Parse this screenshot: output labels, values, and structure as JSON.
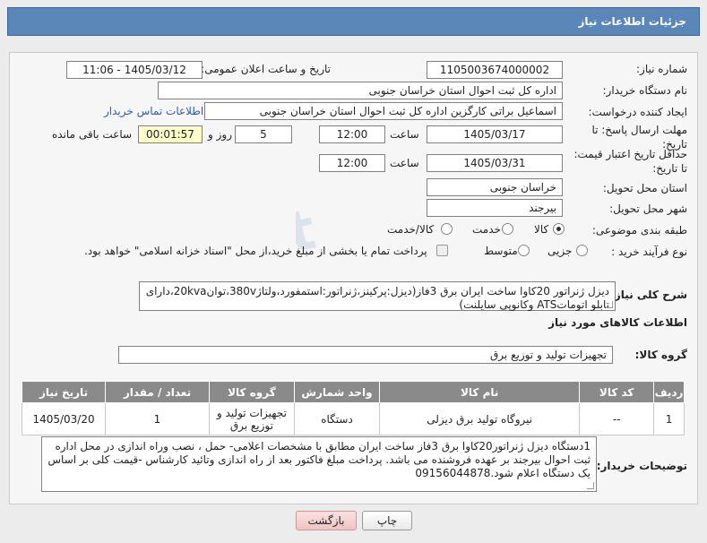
{
  "header": {
    "title": "جزئیات اطلاعات نیاز"
  },
  "fields": {
    "need_number_label": "شماره نیاز:",
    "need_number": "1105003674000002",
    "announce_label": "تاریخ و ساعت اعلان عمومی:",
    "announce_value": "1405/03/12 - 11:06",
    "buyer_label": "نام دستگاه خریدار:",
    "buyer_value": "اداره کل ثبت احوال استان خراسان جنوبی",
    "creator_label": "ایجاد کننده درخواست:",
    "creator_value": "اسماعیل براتی کارگزین اداره کل ثبت احوال استان خراسان جنوبی",
    "contact_link": "اطلاعات تماس خریدار",
    "reply_label_line1": "مهلت ارسال پاسخ: تا",
    "reply_label_line2": "تاریخ:",
    "reply_date": "1405/03/17",
    "time_label": "ساعت",
    "reply_time": "12:00",
    "days_value": "5",
    "days_label": "روز و",
    "remaining_time": "00:01:57",
    "remaining_label": "ساعت باقی مانده",
    "price_label_line1": "حداقل تاریخ اعتبار قیمت:",
    "price_label_line2": "تا تاریخ:",
    "price_date": "1405/03/31",
    "price_time": "12:00",
    "province_label": "استان محل تحویل:",
    "province_value": "خراسان جنوبی",
    "city_label": "شهر محل تحویل:",
    "city_value": "بیرجند",
    "category_label": "طبقه بندی موضوعی:",
    "category_options": [
      "کالا",
      "خدمت",
      "کالا/خدمت"
    ],
    "process_label": "نوع فرآیند خرید :",
    "process_options": [
      "جزیی",
      "متوسط"
    ],
    "payment_note": "پرداخت تمام یا بخشی از مبلغ خرید،از محل \"اسناد خزانه اسلامی\" خواهد بود."
  },
  "summary": {
    "label": "شرح کلی نیاز:",
    "text": "دیزل ژنراتور 20کاوا ساخت ایران برق 3فاز(دیزل:پرکینز،ژنراتور:استمفورد،ولتاژ380v،توان20kva،دارای تابلو اتوماتATS وکانوپی سایلنت)"
  },
  "goods": {
    "section_title": "اطلاعات کالاهای مورد نیاز",
    "group_label": "گروه کالا:",
    "group_value": "تجهیزات تولید و توزیع برق"
  },
  "table": {
    "headers": [
      "ردیف",
      "کد کالا",
      "نام کالا",
      "واحد شمارش",
      "گروه کالا",
      "تعداد / مقدار",
      "تاریخ نیاز"
    ],
    "rows": [
      {
        "row": "1",
        "code": "--",
        "name": "نیروگاه تولید برق دیزلی",
        "unit": "دستگاه",
        "group": "تجهیزات تولید و توزیع برق",
        "qty": "1",
        "date": "1405/03/20"
      }
    ]
  },
  "buyer_notes": {
    "label": "توضیحات خریدار:",
    "text": "1دستگاه دیزل ژنراتور20کاوا برق 3فاز ساخت ایران مطابق با مشخصات اعلامی- حمل ، نصب وراه اندازی در محل اداره ثبت احوال بیرجند بر عهده فروشنده می باشد. پرداخت مبلغ فاکتور بعد از راه اندازی وتائید کارشناس -قیمت کلی بر اساس یک دستگاه اعلام شود.09156044878"
  },
  "buttons": {
    "print": "چاپ",
    "back": "بازگشت"
  },
  "watermark": {
    "text": "AriaTender.net"
  }
}
